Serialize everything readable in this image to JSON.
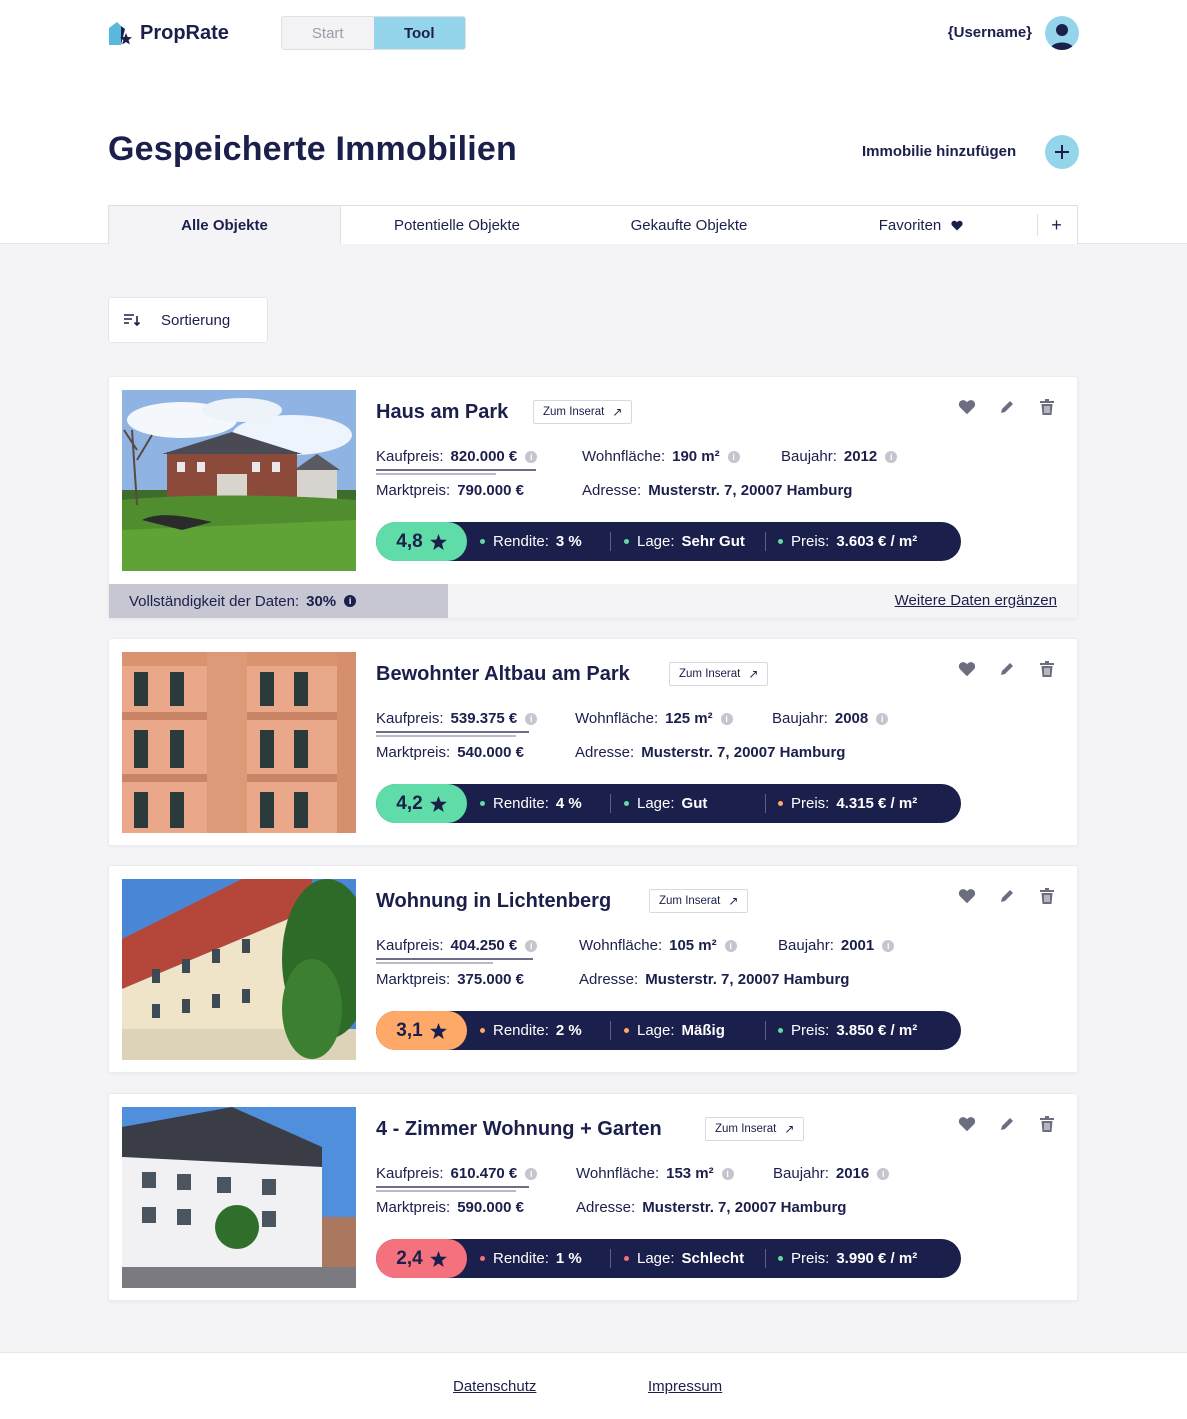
{
  "header": {
    "brand": "PropRate",
    "nav": {
      "start": "Start",
      "tool": "Tool"
    },
    "username": "{Username}"
  },
  "page": {
    "title": "Gespeicherte Immobilien",
    "add_label": "Immobilie hinzufügen",
    "add_icon": "plus-icon"
  },
  "tabs": [
    "Alle Objekte",
    "Potentielle Objekte",
    "Gekaufte Objekte",
    "Favoriten",
    "+"
  ],
  "sort_label": "Sortierung",
  "labels": {
    "inserat": "Zum Inserat",
    "kaufpreis": "Kaufpreis:",
    "marktpreis": "Marktpreis:",
    "wohnflaeche": "Wohnfläche:",
    "adresse": "Adresse:",
    "baujahr": "Baujahr:",
    "rendite": "Rendite:",
    "lage": "Lage:",
    "preis": "Preis:",
    "info": "i"
  },
  "colors": {
    "navy": "#1b1f4b",
    "accent": "#95d5ec",
    "green": "#5fdca7",
    "orange": "#ffa968",
    "red": "#f4727e"
  },
  "properties": [
    {
      "title": "Haus am Park",
      "kaufpreis": "820.000 €",
      "marktpreis": "790.000 €",
      "wohnflaeche": "190 m²",
      "adresse": "Musterstr. 7, 20007 Hamburg",
      "baujahr": "2012",
      "score": "4,8",
      "rendite": "3 %",
      "lage": "Sehr Gut",
      "preis": "3.603 € / m²",
      "completeness": {
        "label": "Vollständigkeit der Daten:",
        "value": "30%",
        "link": "Weitere Daten ergänzen"
      }
    },
    {
      "title": "Bewohnter Altbau am Park",
      "kaufpreis": "539.375 €",
      "marktpreis": "540.000 €",
      "wohnflaeche": "125 m²",
      "adresse": "Musterstr. 7, 20007 Hamburg",
      "baujahr": "2008",
      "score": "4,2",
      "rendite": "4 %",
      "lage": "Gut",
      "preis": "4.315 € / m²"
    },
    {
      "title": "Wohnung in Lichtenberg",
      "kaufpreis": "404.250 €",
      "marktpreis": "375.000 €",
      "wohnflaeche": "105 m²",
      "adresse": "Musterstr. 7, 20007 Hamburg",
      "baujahr": "2001",
      "score": "3,1",
      "rendite": "2 %",
      "lage": "Mäßig",
      "preis": "3.850 € / m²"
    },
    {
      "title": "4 - Zimmer Wohnung + Garten",
      "kaufpreis": "610.470 €",
      "marktpreis": "590.000 €",
      "wohnflaeche": "153 m²",
      "adresse": "Musterstr. 7, 20007 Hamburg",
      "baujahr": "2016",
      "score": "2,4",
      "rendite": "1 %",
      "lage": "Schlecht",
      "preis": "3.990 € / m²"
    }
  ],
  "footer": {
    "privacy": "Datenschutz",
    "imprint": "Impressum"
  }
}
